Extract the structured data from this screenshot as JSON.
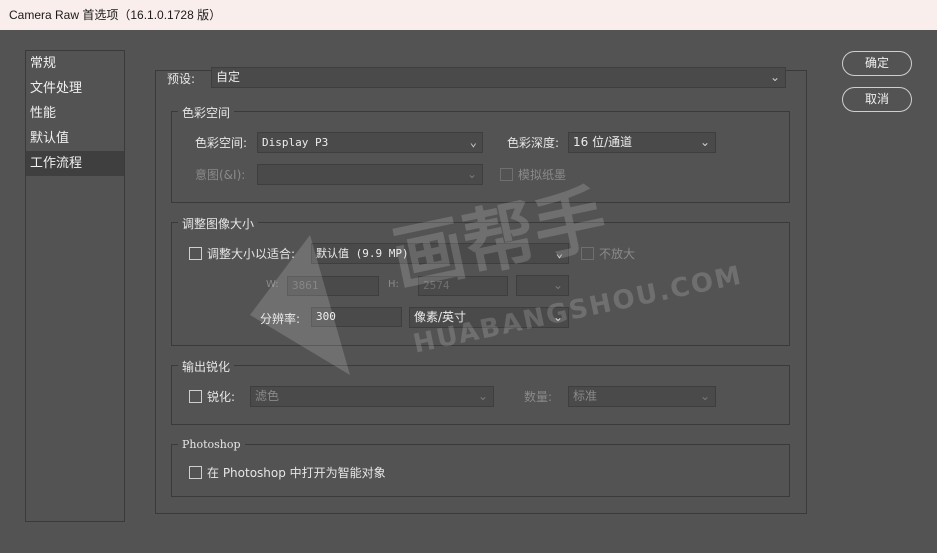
{
  "window": {
    "title": "Camera Raw 首选项（16.1.0.1728 版）"
  },
  "nav": {
    "items": [
      {
        "label": "常规"
      },
      {
        "label": "文件处理"
      },
      {
        "label": "性能"
      },
      {
        "label": "默认值"
      },
      {
        "label": "工作流程"
      }
    ],
    "active_index": 4
  },
  "buttons": {
    "ok": "确定",
    "cancel": "取消"
  },
  "preset": {
    "label": "预设:",
    "value": "自定"
  },
  "color_space_group": {
    "title": "色彩空间",
    "space_label": "色彩空间:",
    "space_value": "Display P3",
    "depth_label": "色彩深度:",
    "depth_value": "16 位/通道",
    "intent_label": "意图(&I):",
    "intent_value": "",
    "simulate_paper_label": "模拟纸墨"
  },
  "resize_group": {
    "title": "调整图像大小",
    "fit_label": "调整大小以适合:",
    "fit_value": "默认值 (9.9 MP)",
    "no_enlarge_label": "不放大",
    "w_label": "W:",
    "w_value": "3861",
    "h_label": "H:",
    "h_value": "2574",
    "resolution_label": "分辨率:",
    "resolution_value": "300",
    "resolution_unit": "像素/英寸"
  },
  "sharpen_group": {
    "title": "输出锐化",
    "sharpen_label": "锐化:",
    "sharpen_value": "滤色",
    "amount_label": "数量:",
    "amount_value": "标准"
  },
  "photoshop_group": {
    "title": "Photoshop",
    "open_as_smart_label": "在 Photoshop 中打开为智能对象"
  },
  "watermark": {
    "brand": "画帮手",
    "url": "HUABANGSHOU.COM"
  }
}
